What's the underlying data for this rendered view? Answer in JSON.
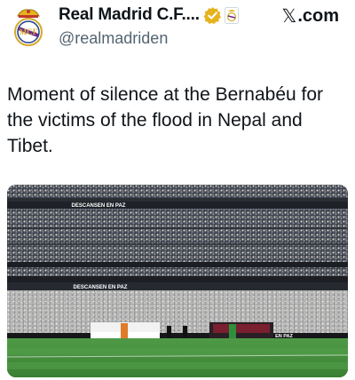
{
  "author": {
    "display_name": "Real Madrid C.F....",
    "handle": "@realmadriden",
    "avatar_icon": "real-madrid-crest-icon",
    "verified_icon": "gold-verified-badge-icon",
    "affiliate_icon": "real-madrid-affiliate-badge-icon"
  },
  "watermark": {
    "glyph": "𝕏",
    "text": ".com"
  },
  "tweet": {
    "text": "Moment of silence at the Bernabéu for the victims of the flood in Nepal and Tibet."
  },
  "media": {
    "description_icon": "stadium-photo",
    "banner_upper": "DESCANSEN EN PAZ",
    "banner_lower": "DESCANSEN EN PAZ",
    "banner_field": "EN PAZ"
  },
  "colors": {
    "verified_gold": "#e6b31e",
    "pitch_green": "#3f8a3a",
    "text_primary": "#0f1419",
    "text_secondary": "#536471"
  }
}
